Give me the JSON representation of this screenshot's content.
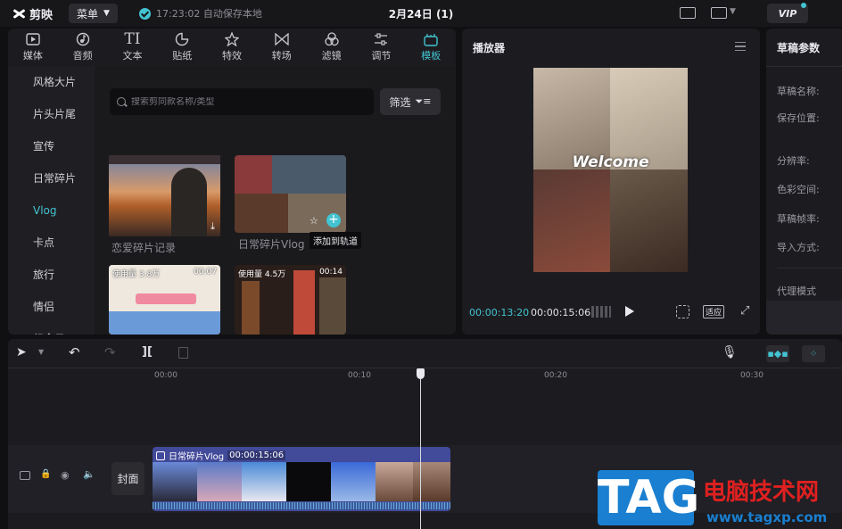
{
  "app": {
    "name": "剪映",
    "menu_label": "菜单",
    "autosave": "17:23:02 自动保存本地",
    "doc_title": "2月24日 (1)",
    "vip": "VIP"
  },
  "tabs": [
    {
      "label": "媒体",
      "icon": "media-icon"
    },
    {
      "label": "音频",
      "icon": "audio-icon"
    },
    {
      "label": "文本",
      "icon": "text-icon"
    },
    {
      "label": "贴纸",
      "icon": "sticker-icon"
    },
    {
      "label": "特效",
      "icon": "effects-icon"
    },
    {
      "label": "转场",
      "icon": "transition-icon"
    },
    {
      "label": "滤镜",
      "icon": "filter-icon"
    },
    {
      "label": "调节",
      "icon": "adjust-icon"
    },
    {
      "label": "模板",
      "icon": "template-icon",
      "active": true
    }
  ],
  "sidebar": [
    "风格大片",
    "片头片尾",
    "宣传",
    "日常碎片",
    "Vlog",
    "卡点",
    "旅行",
    "情侣",
    "纪念日"
  ],
  "search": {
    "placeholder": "搜索剪同款名称/类型"
  },
  "filter_label": "筛选",
  "templates": [
    {
      "label": "恋爱碎片记录"
    },
    {
      "label": "日常碎片Vlog",
      "tooltip": "添加到轨道"
    },
    {
      "usage": "使用量 3.8万",
      "duration": "00:07"
    },
    {
      "usage": "使用量 4.5万",
      "duration": "00:14"
    }
  ],
  "player": {
    "title": "播放器",
    "current_time": "00:00:13:20",
    "total_time": "00:00:15:06",
    "fit_label": "适应",
    "overlay_text": "Welcome"
  },
  "params": {
    "title": "草稿参数",
    "rows": [
      "草稿名称:",
      "保存位置:",
      "分辨率:",
      "色彩空间:",
      "草稿帧率:",
      "导入方式:",
      "代理模式"
    ]
  },
  "timeline": {
    "ticks": [
      "00:00",
      "00:10",
      "00:20",
      "00:30"
    ],
    "cover_label": "封面",
    "clip_title": "日常碎片Vlog",
    "clip_duration": "00:00:15:06"
  },
  "watermark": {
    "tag": "TAG",
    "text": "电脑技术网",
    "url": "www.tagxp.com"
  },
  "colors": {
    "accent": "#43c3d1",
    "clip": "#424a9a"
  }
}
